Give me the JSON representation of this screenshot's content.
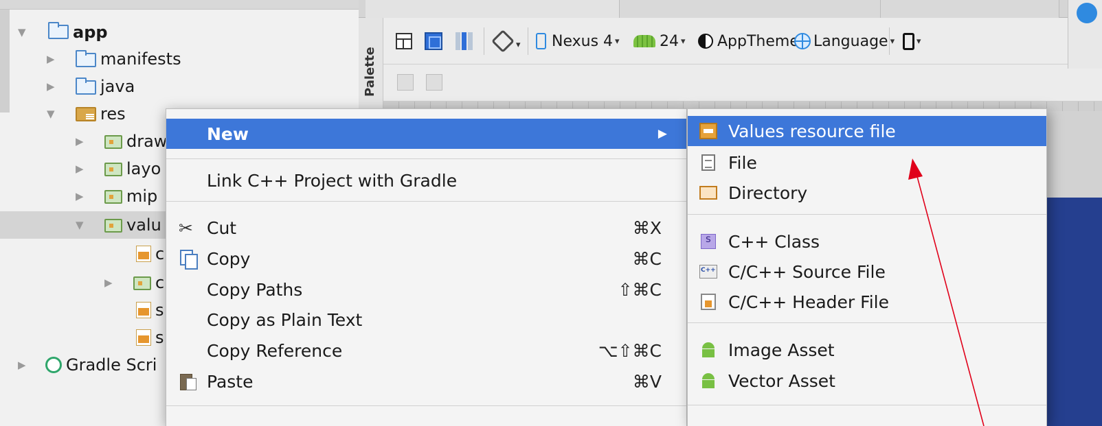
{
  "project_tree": {
    "items": [
      {
        "label": "app",
        "expanded": true,
        "icon": "module-folder-icon"
      },
      {
        "label": "manifests",
        "expanded": false,
        "icon": "folder-icon"
      },
      {
        "label": "java",
        "expanded": false,
        "icon": "folder-icon"
      },
      {
        "label": "res",
        "expanded": true,
        "icon": "res-folder-icon"
      },
      {
        "label": "draw",
        "expanded": false,
        "icon": "res-folder-icon"
      },
      {
        "label": "layo",
        "expanded": false,
        "icon": "res-folder-icon"
      },
      {
        "label": "mip",
        "expanded": false,
        "icon": "res-folder-icon"
      },
      {
        "label": "valu",
        "expanded": true,
        "selected": true,
        "icon": "res-folder-icon"
      },
      {
        "label": "c",
        "icon": "xml-file-icon"
      },
      {
        "label": "c",
        "expanded": false,
        "icon": "res-folder-icon"
      },
      {
        "label": "s",
        "icon": "xml-file-icon"
      },
      {
        "label": "s",
        "icon": "xml-file-icon"
      },
      {
        "label": "Gradle Scri",
        "expanded": false,
        "icon": "gradle-icon"
      }
    ]
  },
  "editor": {
    "palette_label": "Palette",
    "toolbar": {
      "device": "Nexus 4",
      "api_level": "24",
      "theme": "AppTheme",
      "language": "Language"
    }
  },
  "context_menu": {
    "items": [
      {
        "label": "New",
        "highlighted": true,
        "has_submenu": true
      },
      {
        "label": "Link C++ Project with Gradle"
      },
      {
        "label": "Cut",
        "shortcut": "⌘X",
        "icon": "scissors-icon"
      },
      {
        "label": "Copy",
        "shortcut": "⌘C",
        "icon": "copy-icon"
      },
      {
        "label": "Copy Paths",
        "shortcut": "⇧⌘C"
      },
      {
        "label": "Copy as Plain Text"
      },
      {
        "label": "Copy Reference",
        "shortcut": "⌥⇧⌘C"
      },
      {
        "label": "Paste",
        "shortcut": "⌘V",
        "icon": "paste-icon"
      }
    ]
  },
  "submenu": {
    "items": [
      {
        "label": "Values resource file",
        "highlighted": true,
        "icon": "values-resource-icon"
      },
      {
        "label": "File",
        "icon": "file-icon"
      },
      {
        "label": "Directory",
        "icon": "directory-icon"
      },
      {
        "label": "C++ Class",
        "icon": "cpp-class-icon"
      },
      {
        "label": "C/C++ Source File",
        "icon": "cpp-source-icon"
      },
      {
        "label": "C/C++ Header File",
        "icon": "cpp-header-icon"
      },
      {
        "label": "Image Asset",
        "icon": "android-icon"
      },
      {
        "label": "Vector Asset",
        "icon": "android-icon"
      }
    ]
  },
  "colors": {
    "highlight": "#3d77d9",
    "annotation_arrow": "#e0001a"
  }
}
